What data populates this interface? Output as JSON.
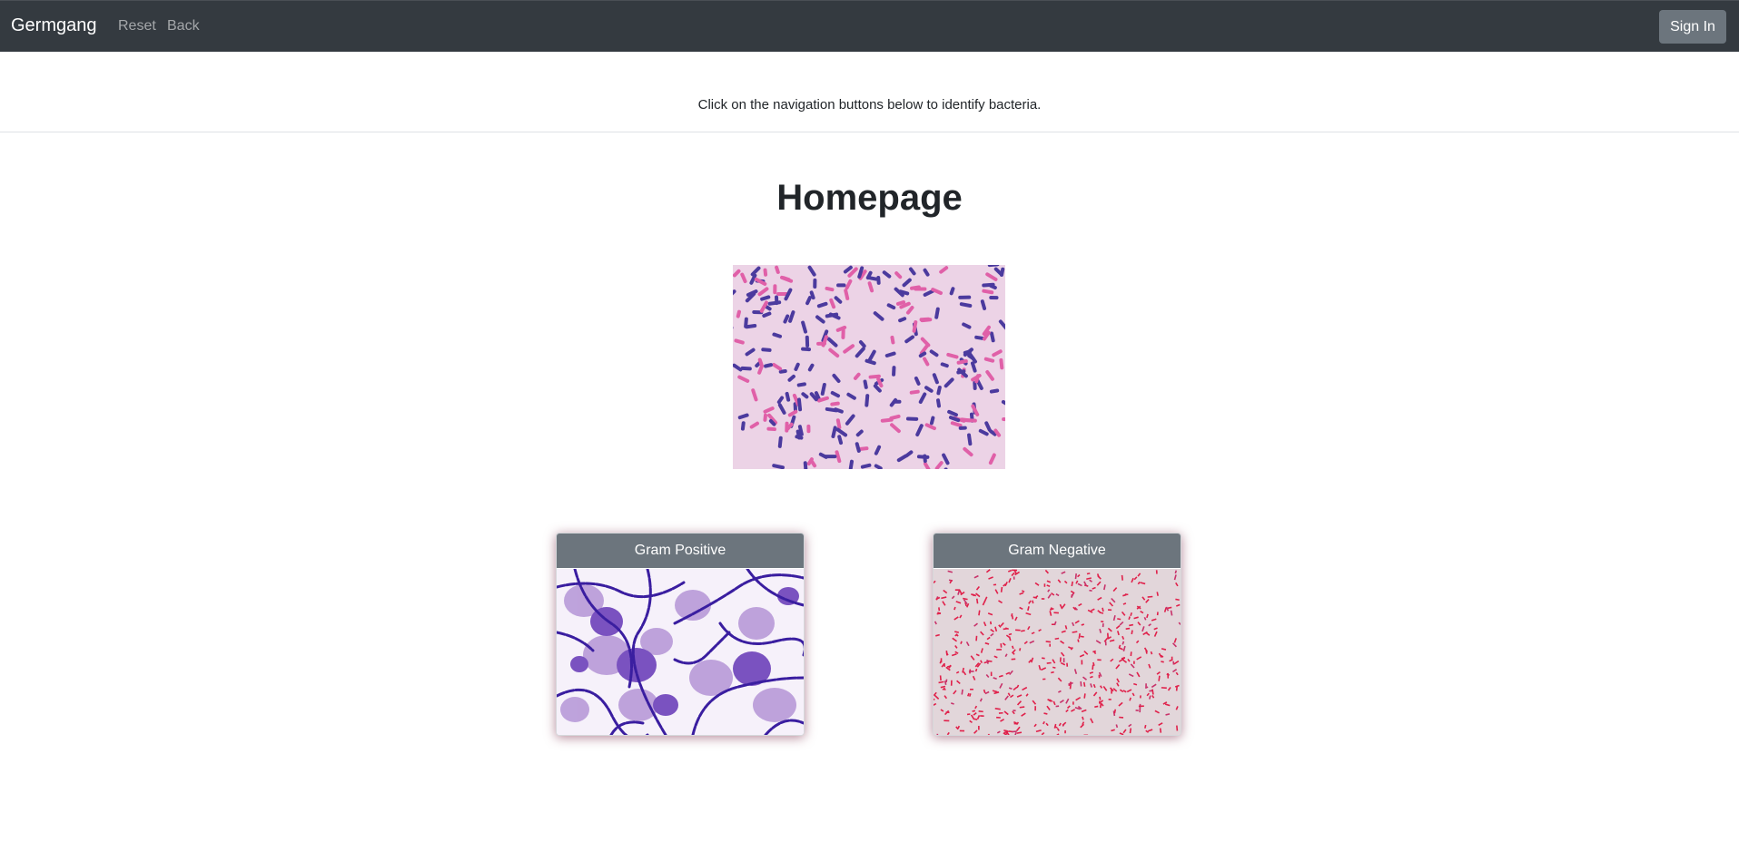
{
  "navbar": {
    "brand": "Germgang",
    "links": [
      "Reset",
      "Back"
    ],
    "signin_label": "Sign In"
  },
  "instruction": "Click on the navigation buttons below to identify bacteria.",
  "page_title": "Homepage",
  "cards": [
    {
      "label": "Gram Positive"
    },
    {
      "label": "Gram Negative"
    }
  ],
  "colors": {
    "navbar_bg": "#343a40",
    "button_bg": "#6c757d",
    "gram_positive_stain": "#3a2aa0",
    "gram_negative_stain": "#e0204a"
  }
}
